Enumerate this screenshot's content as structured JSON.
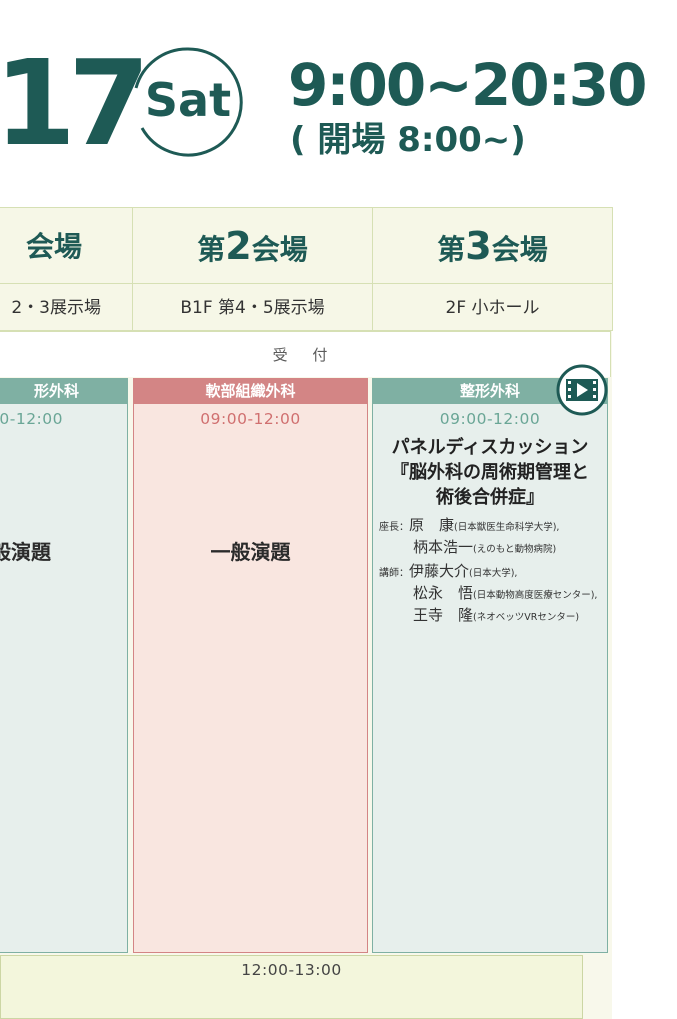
{
  "header": {
    "day": "17",
    "weekday": "Sat",
    "time": "9:00~20:30",
    "doors_open": "( 開場 8:00~)"
  },
  "halls": [
    {
      "name_pre": "",
      "name_num": "",
      "name_post": "会場",
      "floor": "2・3展示場"
    },
    {
      "name_pre": "第",
      "name_num": "2",
      "name_post": "会場",
      "floor": "B1F 第4・5展示場"
    },
    {
      "name_pre": "第",
      "name_num": "3",
      "name_post": "会場",
      "floor": "2F 小ホール"
    }
  ],
  "reception": "受 付",
  "sessions": [
    {
      "category": "形外科",
      "time": "0-12:00",
      "title": "般演題"
    },
    {
      "category": "軟部組織外科",
      "time": "09:00-12:00",
      "title": "一般演題"
    },
    {
      "category": "整形外科",
      "time": "09:00-12:00",
      "type": "パネルディスカッション",
      "title_line1": "『脳外科の周術期管理と",
      "title_line2": "術後合併症』",
      "chair_label": "座長：",
      "chairs": [
        {
          "name": "原　康",
          "affiliation": "(日本獣医生命科学大学),"
        },
        {
          "name": "柄本浩一",
          "affiliation": "(えのもと動物病院)"
        }
      ],
      "lecturer_label": "講師：",
      "lecturers": [
        {
          "name": "伊藤大介",
          "affiliation": "(日本大学),"
        },
        {
          "name": "松永　悟",
          "affiliation": "(日本動物高度医療センター),"
        },
        {
          "name": "王寺　隆",
          "affiliation": "(ネオベッツVRセンター)"
        }
      ]
    }
  ],
  "lunch_time": "12:00-13:00",
  "colors": {
    "brand": "#1e5a55",
    "teal_block": "#7fb0a3",
    "pink_block": "#d38585",
    "header_bg": "#f6f7e7"
  }
}
